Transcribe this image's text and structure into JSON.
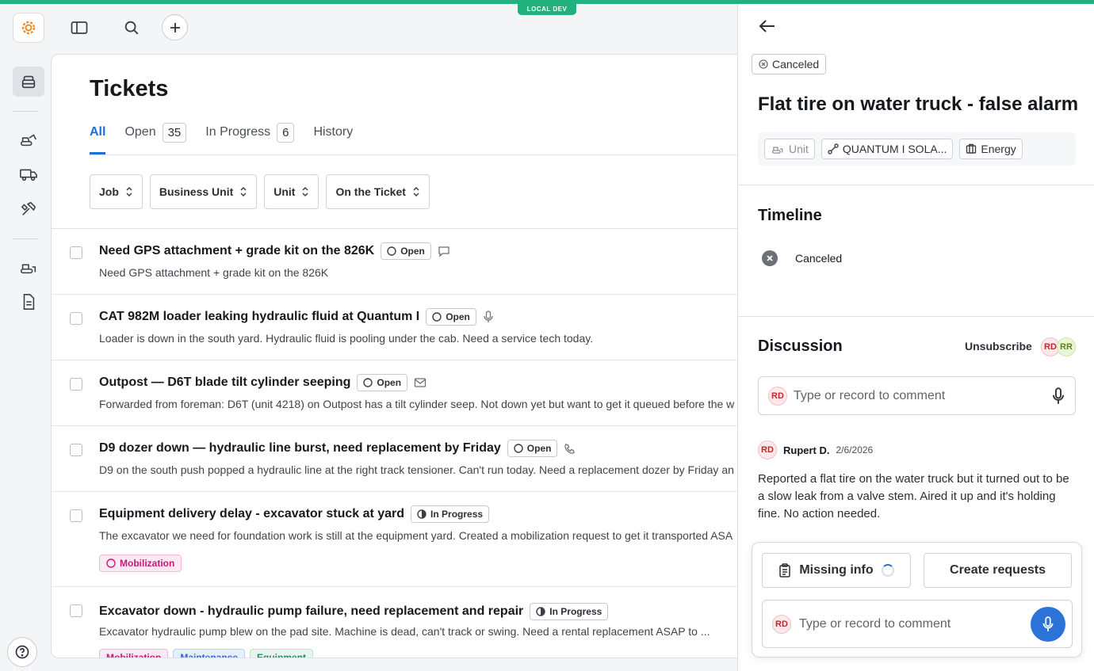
{
  "env": {
    "label": "LOCAL DEV"
  },
  "main": {
    "title": "Tickets",
    "tabs": [
      {
        "label": "All",
        "count": null
      },
      {
        "label": "Open",
        "count": "35"
      },
      {
        "label": "In Progress",
        "count": "6"
      },
      {
        "label": "History",
        "count": null
      }
    ],
    "filters": [
      "Job",
      "Business Unit",
      "Unit",
      "On the Ticket"
    ],
    "tickets": [
      {
        "title": "Need GPS attachment + grade kit on the 826K",
        "status": "Open",
        "channel": "chat-icon",
        "desc": "Need GPS attachment + grade kit on the 826K",
        "tags": []
      },
      {
        "title": "CAT 982M loader leaking hydraulic fluid at Quantum I",
        "status": "Open",
        "channel": "mic-icon",
        "desc": "Loader is down in the south yard. Hydraulic fluid is pooling under the cab. Need a service tech today.",
        "tags": []
      },
      {
        "title": "Outpost — D6T blade tilt cylinder seeping",
        "status": "Open",
        "channel": "mail-icon",
        "desc": "Forwarded from foreman: D6T (unit 4218) on Outpost has a tilt cylinder seep. Not down yet but want to get it queued before the w",
        "tags": []
      },
      {
        "title": "D9 dozer down — hydraulic line burst, need replacement by Friday",
        "status": "Open",
        "channel": "phone-icon",
        "desc": "D9 on the south push popped a hydraulic line at the right track tensioner. Can't run today. Need a replacement dozer by Friday an",
        "tags": []
      },
      {
        "title": "Equipment delivery delay - excavator stuck at yard",
        "status": "In Progress",
        "channel": "",
        "desc": "The excavator we need for foundation work is still at the equipment yard. Created a mobilization request to get it transported ASA",
        "tags": [
          "Mobilization"
        ]
      },
      {
        "title": "Excavator down - hydraulic pump failure, need replacement and repair",
        "status": "In Progress",
        "channel": "",
        "desc": "Excavator hydraulic pump blew on the pad site. Machine is dead, can't track or swing. Need a rental replacement ASAP to ...",
        "tags": [
          "Mobilization",
          "Maintenance",
          "Equipment"
        ]
      }
    ]
  },
  "detail": {
    "status": "Canceled",
    "title": "Flat tire on water truck - false alarm",
    "chips": [
      "Unit",
      "QUANTUM I SOLA...",
      "Energy"
    ],
    "timeline_heading": "Timeline",
    "timeline": [
      {
        "label": "Canceled"
      }
    ],
    "discussion_heading": "Discussion",
    "unsubscribe": "Unsubscribe",
    "participants": [
      "RD",
      "RR"
    ],
    "comment_placeholder": "Type or record to comment",
    "comment": {
      "initials": "RD",
      "author": "Rupert D.",
      "date": "2/6/2026",
      "text": "Reported a flat tire on the water truck but it turned out to be a slow leak from a valve stem. Aired it up and it's holding fine. No action needed."
    },
    "actions": {
      "missing_info": "Missing info",
      "create_requests": "Create requests"
    },
    "composer_placeholder": "Type or record to comment",
    "user_initials": "RD"
  },
  "colors": {
    "accent": "#1f6fd1",
    "env": "#22b07d",
    "mic": "#2b73d6"
  }
}
